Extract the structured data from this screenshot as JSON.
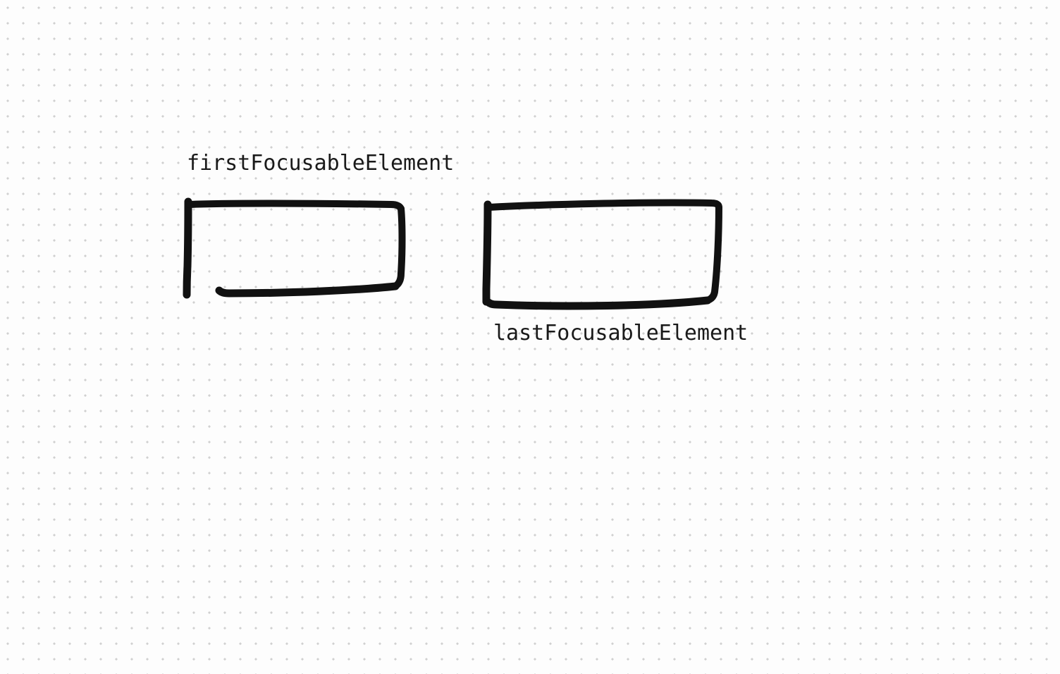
{
  "diagram": {
    "labels": {
      "first": "firstFocusableElement",
      "last": "lastFocusableElement"
    },
    "shapes": [
      {
        "name": "first-focusable-box"
      },
      {
        "name": "last-focusable-box"
      }
    ]
  }
}
